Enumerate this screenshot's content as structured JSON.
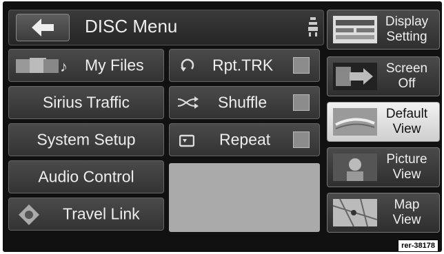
{
  "header": {
    "title": "DISC Menu"
  },
  "left_buttons": [
    "My Files",
    "Sirius Traffic",
    "System Setup",
    "Audio Control",
    "Travel Link"
  ],
  "toggles": [
    {
      "label": "Rpt.TRK",
      "checked": false
    },
    {
      "label": "Shuffle",
      "checked": false
    },
    {
      "label": "Repeat",
      "checked": false
    }
  ],
  "right_buttons": [
    {
      "label": "Display Setting",
      "active": false
    },
    {
      "label": "Screen Off",
      "active": false
    },
    {
      "label": "Default View",
      "active": true
    },
    {
      "label": "Picture View",
      "active": false
    },
    {
      "label": "Map View",
      "active": false
    }
  ],
  "reference_tag": "rer-38178"
}
